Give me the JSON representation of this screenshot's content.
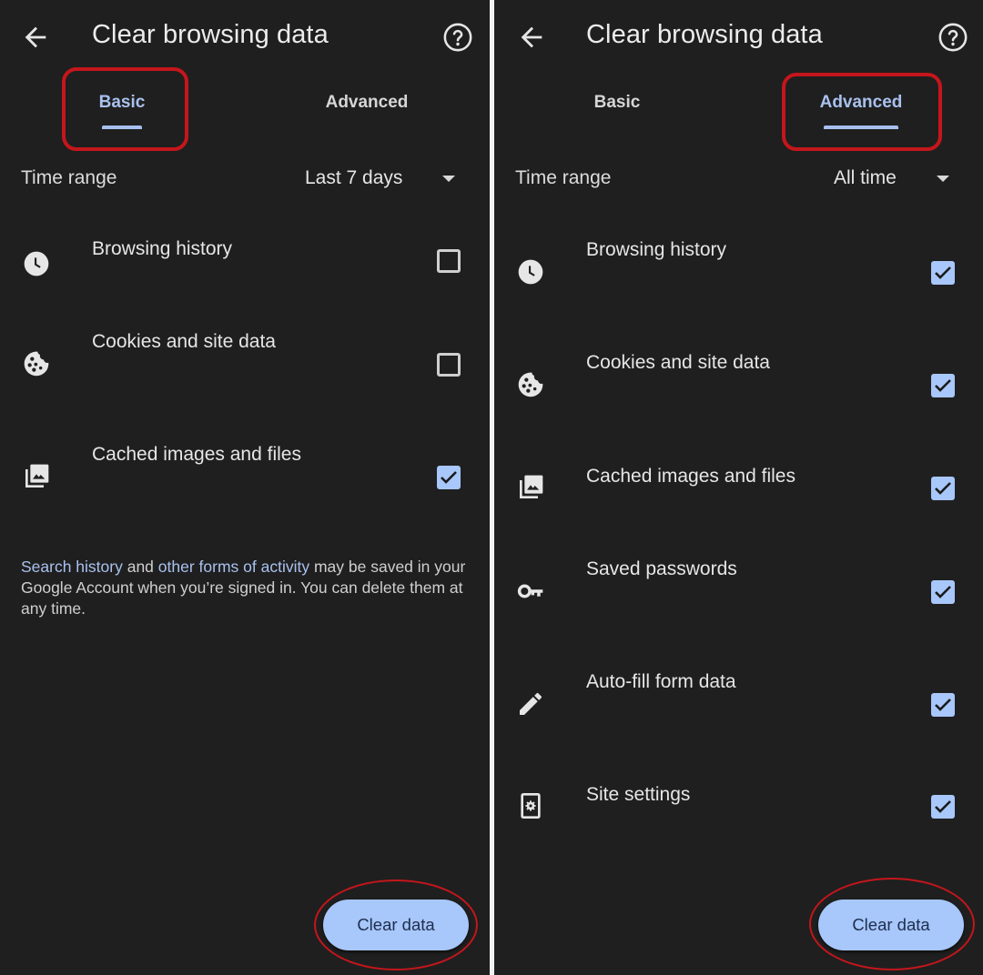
{
  "colors": {
    "background": "#1f1f1f",
    "accent": "#a8c7fa",
    "active_tab_text": "#a9c1ee",
    "annotation": "#c4161c",
    "divider": "#f2f2f2"
  },
  "screens": [
    {
      "id": "basic",
      "appbar": {
        "back_icon": "arrow-back-icon",
        "title": "Clear browsing data",
        "help_icon": "help-circle-icon"
      },
      "tabs": [
        {
          "label": "Basic",
          "active": true
        },
        {
          "label": "Advanced",
          "active": false
        }
      ],
      "time_range": {
        "label": "Time range",
        "value": "Last 7 days",
        "icon": "dropdown-caret-icon"
      },
      "items": [
        {
          "label": "Browsing history",
          "icon": "clock-icon",
          "checked": false
        },
        {
          "label": "Cookies and site data",
          "icon": "cookie-icon",
          "checked": false
        },
        {
          "label": "Cached images and files",
          "icon": "image-stack-icon",
          "checked": true
        }
      ],
      "note": {
        "link1": "Search history",
        "text1": " and ",
        "link2": "other forms of activity",
        "text2": " may be saved in your Google Account when you’re signed in. You can delete them at any time."
      },
      "clear_button": "Clear data"
    },
    {
      "id": "advanced",
      "appbar": {
        "back_icon": "arrow-back-icon",
        "title": "Clear browsing data",
        "help_icon": "help-circle-icon"
      },
      "tabs": [
        {
          "label": "Basic",
          "active": false
        },
        {
          "label": "Advanced",
          "active": true
        }
      ],
      "time_range": {
        "label": "Time range",
        "value": "All time",
        "icon": "dropdown-caret-icon"
      },
      "items": [
        {
          "label": "Browsing history",
          "icon": "clock-icon",
          "checked": true
        },
        {
          "label": "Cookies and site data",
          "icon": "cookie-icon",
          "checked": true
        },
        {
          "label": "Cached images and files",
          "icon": "image-stack-icon",
          "checked": true
        },
        {
          "label": "Saved passwords",
          "icon": "key-icon",
          "checked": true
        },
        {
          "label": "Auto-fill form data",
          "icon": "pencil-icon",
          "checked": true
        },
        {
          "label": "Site settings",
          "icon": "site-settings-icon",
          "checked": true
        }
      ],
      "clear_button": "Clear data"
    }
  ]
}
